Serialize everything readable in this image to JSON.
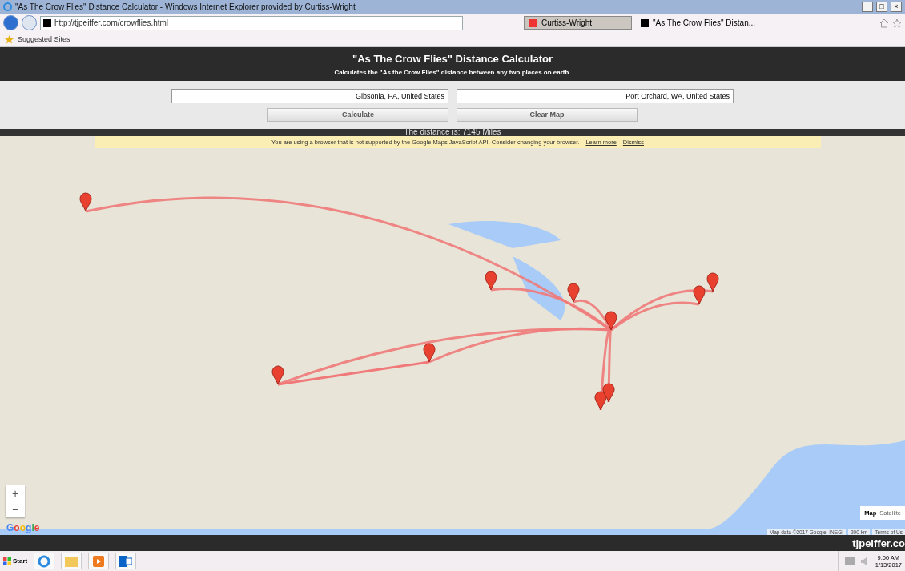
{
  "window": {
    "title": "\"As The Crow Flies\" Distance Calculator - Windows Internet Explorer provided by Curtiss-Wright",
    "controls": [
      "_",
      "□",
      "×"
    ]
  },
  "browser": {
    "address": "http://tjpeiffer.com/crowflies.html",
    "tabs": [
      {
        "label": "Curtiss-Wright",
        "selected": false
      },
      {
        "label": "\"As The Crow Flies\" Distan...",
        "selected": true
      }
    ],
    "favorites": [
      "Suggested Sites"
    ]
  },
  "page": {
    "title": "\"As The Crow Flies\" Distance Calculator",
    "subtitle": "Calculates the \"As the Crow Flies\" distance between any two places on earth.",
    "origin": "Gibsonia, PA, United States",
    "destination": "Port Orchard, WA, United States",
    "buttons": [
      "Calculate",
      "Clear Map"
    ],
    "distance": "The distance is: 7145 Miles"
  },
  "banner": {
    "message": "You are using a browser that is not supported by the Google Maps JavaScript API. Consider changing your browser.",
    "links": [
      "Learn more",
      "Dismiss"
    ]
  },
  "map": {
    "zoom": [
      "+",
      "−"
    ],
    "logo": "Google",
    "types": [
      {
        "label": "Map",
        "selected": true
      },
      {
        "label": "Satellite",
        "selected": false
      }
    ],
    "attribution": [
      "Map data ©2017 Google, INEGI",
      "200 km",
      "Terms of Us"
    ]
  },
  "footer": {
    "site": "tjpeiffer.co"
  },
  "taskbar": {
    "start": "Start",
    "time": "9:00 AM",
    "date": "1/13/2017"
  }
}
